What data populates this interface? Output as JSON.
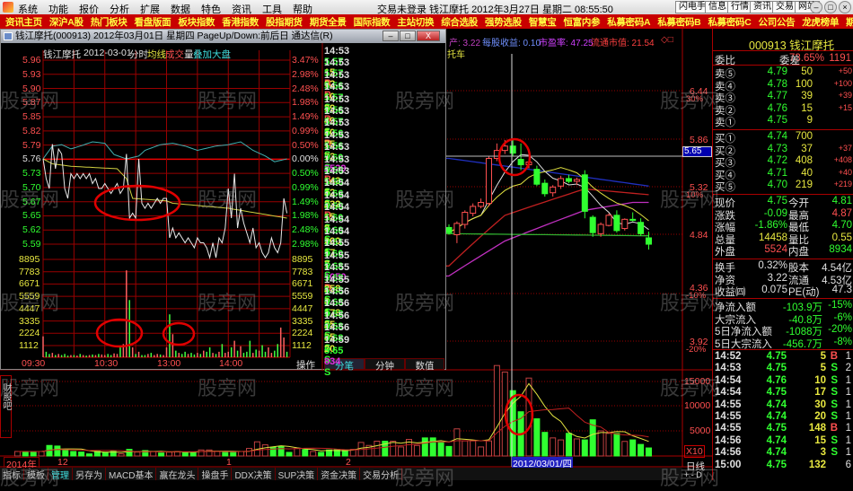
{
  "menubar": {
    "items": [
      "系统",
      "功能",
      "报价",
      "分析",
      "扩展",
      "数据",
      "特色",
      "资讯",
      "工具",
      "帮助"
    ],
    "status": "交易未登录 钱江摩托 2012年3月27日 星期二 08:55:50",
    "buttons": [
      "闪电手",
      "信息",
      "行情",
      "资讯",
      "交易",
      "网站"
    ]
  },
  "navbar": {
    "items": [
      "资讯主页",
      "深沪A股",
      "热门板块",
      "看盘版面",
      "板块指数",
      "香港指数",
      "股指期货",
      "期货全景",
      "国际指数",
      "主站切换",
      "综合选股",
      "强势选股",
      "智慧宝",
      "恒富内参",
      "私募密码A",
      "私募密码B",
      "私募密码C",
      "公司公告",
      "龙虎榜单",
      "期货龙虎"
    ]
  },
  "watermark": "股旁网",
  "popup": {
    "title": "钱江摩托(000913) 2012年03月01日 星期四 PageUp/Down:前后日 通达信(R)",
    "header": {
      "name": "钱江摩托",
      "date": "2012-03-01",
      "mode": "分时",
      "avg": "均线",
      "vol1": "成交",
      "vol2": "量",
      "overlay": "叠加大盘"
    },
    "price_labels": [
      "5.96",
      "5.93",
      "5.90",
      "5.87",
      "5.85",
      "5.82",
      "5.79",
      "5.76",
      "5.73",
      "5.70",
      "5.67",
      "5.65",
      "5.62",
      "5.59"
    ],
    "pct_labels": [
      "3.47%",
      "2.98%",
      "2.48%",
      "1.98%",
      "1.49%",
      "0.99%",
      "0.50%",
      "0.00%",
      "0.50%",
      "0.99%",
      "1.49%",
      "1.98%",
      "2.48%",
      "2.98%"
    ],
    "vol_labels": [
      "8895",
      "7783",
      "6671",
      "5559",
      "4447",
      "3335",
      "2224",
      "1112"
    ],
    "time_labels": [
      "09:30",
      "10:30",
      "13:00",
      "14:00"
    ],
    "op_label": "操作",
    "tabs": [
      "分笔",
      "分钟",
      "数值"
    ],
    "trades": [
      {
        "t": "14:53",
        "p": "5.57",
        "v": "15",
        "bs": "B"
      },
      {
        "t": "14:53",
        "p": "5.57",
        "v": "62",
        "bs": "B"
      },
      {
        "t": "14:53",
        "p": "5.56",
        "v": "10",
        "bs": "S"
      },
      {
        "t": "14:53",
        "p": "5.57",
        "v": "39",
        "bs": "B"
      },
      {
        "t": "14:53",
        "p": "5.56",
        "v": "49",
        "bs": "S"
      },
      {
        "t": "14:53",
        "p": "5.57",
        "v": "50",
        "bs": "B"
      },
      {
        "t": "14:53",
        "p": "5.56",
        "v": "75",
        "bs": "S"
      },
      {
        "t": "14:53",
        "p": "5.56",
        "v": "73",
        "bs": "S"
      },
      {
        "t": "14:53",
        "p": "5.60",
        "v": "2529",
        "bs": "B",
        "big": true
      },
      {
        "t": "14:53",
        "p": "5.60",
        "v": "143",
        "bs": "S"
      },
      {
        "t": "14:53",
        "p": "5.60",
        "v": "52",
        "bs": "S"
      },
      {
        "t": "14:54",
        "p": "5.66",
        "v": "232",
        "bs": "B"
      },
      {
        "t": "14:54",
        "p": "5.60",
        "v": "15",
        "bs": "S"
      },
      {
        "t": "14:54",
        "p": "5.60",
        "v": "8",
        "bs": "S"
      },
      {
        "t": "14:54",
        "p": "5.60",
        "v": "200",
        "bs": "S"
      },
      {
        "t": "14:54",
        "p": "5.61",
        "v": "17",
        "bs": "S"
      },
      {
        "t": "14:55",
        "p": "5.60",
        "v": "7",
        "bs": "S"
      },
      {
        "t": "14:55",
        "p": "5.68",
        "v": "1050",
        "bs": "B",
        "big": true
      },
      {
        "t": "14:55",
        "p": "5.68",
        "v": "258",
        "bs": "S"
      },
      {
        "t": "14:55",
        "p": "5.68",
        "v": "3",
        "bs": "S"
      },
      {
        "t": "14:56",
        "p": "5.68",
        "v": "178",
        "bs": "S"
      },
      {
        "t": "14:56",
        "p": "5.68",
        "v": "25",
        "bs": "S"
      },
      {
        "t": "14:56",
        "p": "5.68",
        "v": "35",
        "bs": "S"
      },
      {
        "t": "14:56",
        "p": "5.68",
        "v": "20",
        "bs": "S"
      },
      {
        "t": "14:59",
        "p": "5.65",
        "v": "834",
        "bs": "S",
        "big": true
      }
    ]
  },
  "intraday": {
    "prev_close": 5.76,
    "price": [
      5.76,
      5.72,
      5.7,
      5.79,
      5.74,
      5.78,
      5.77,
      5.7,
      5.68,
      5.73,
      5.72,
      5.73,
      5.72,
      5.73,
      5.72,
      5.73,
      5.71,
      5.72,
      5.7,
      5.7,
      5.71,
      5.7,
      5.69,
      5.7,
      5.71,
      5.69,
      5.7,
      5.77,
      5.64,
      5.65,
      5.64,
      5.76,
      5.67,
      5.66,
      5.67,
      5.66,
      5.67,
      5.68,
      5.67,
      5.68,
      5.68,
      5.6,
      5.62,
      5.6,
      5.61,
      5.6,
      5.59,
      5.6,
      5.59,
      5.58,
      5.6,
      5.59,
      5.59,
      5.58,
      5.56,
      5.59,
      5.56,
      5.6,
      5.59,
      5.62,
      5.7,
      5.64,
      5.73,
      5.62,
      5.66,
      5.63,
      5.61,
      5.59,
      5.62,
      5.58,
      5.59,
      5.57,
      5.56,
      5.57,
      5.6,
      5.58,
      5.57,
      5.59,
      5.68,
      5.65
    ],
    "avg_knots": [
      [
        0,
        5.76
      ],
      [
        3,
        5.75
      ],
      [
        9,
        5.745
      ],
      [
        24,
        5.74
      ],
      [
        27,
        5.72
      ],
      [
        29,
        5.68
      ],
      [
        40,
        5.675
      ],
      [
        42,
        5.67
      ],
      [
        60,
        5.66
      ],
      [
        79,
        5.64
      ]
    ],
    "index_pct_knots": [
      [
        0,
        0
      ],
      [
        3,
        0.45
      ],
      [
        6,
        0.5
      ],
      [
        9,
        0.35
      ],
      [
        12,
        0.45
      ],
      [
        16,
        0.6
      ],
      [
        20,
        0.55
      ],
      [
        23,
        0.15
      ],
      [
        27,
        0.0
      ],
      [
        31,
        0.1
      ],
      [
        33,
        0.3
      ],
      [
        38,
        0.5
      ],
      [
        42,
        0.55
      ],
      [
        46,
        0.45
      ],
      [
        50,
        0.3
      ],
      [
        56,
        0.45
      ],
      [
        60,
        0.5
      ],
      [
        64,
        0.6
      ],
      [
        68,
        0.3
      ],
      [
        72,
        0.1
      ],
      [
        75,
        -0.1
      ],
      [
        79,
        0.0
      ]
    ],
    "volume": [
      1900,
      500,
      300,
      400,
      200,
      300,
      200,
      300,
      150,
      200,
      200,
      150,
      300,
      200,
      150,
      200,
      250,
      200,
      300,
      250,
      200,
      300,
      200,
      350,
      300,
      900,
      1200,
      7900,
      5200,
      900,
      300,
      500,
      200,
      200,
      300,
      400,
      200,
      300,
      250,
      200,
      900,
      3900,
      2100,
      600,
      400,
      300,
      500,
      300,
      400,
      250,
      400,
      300,
      600,
      500,
      900,
      400,
      300,
      500,
      1200,
      400,
      500,
      900,
      1500,
      600,
      1000,
      400,
      500,
      1500,
      400,
      700,
      600,
      1100,
      500,
      900,
      400,
      600,
      1200,
      2700,
      1800,
      500
    ]
  },
  "kline": {
    "header": {
      "a": "产: 3.22",
      "b": "每股收益: 0.10",
      "c": "市盈率: 47.25",
      "d": "流通市值: 21.54",
      "sub": "托车",
      "icons": "◇□"
    },
    "axis": [
      {
        "p": "6.44",
        "pct": "30%"
      },
      {
        "p": "5.86",
        "pct": ""
      },
      {
        "p": "5.32",
        "pct": "10%"
      },
      {
        "p": "4.84",
        "pct": ""
      },
      {
        "p": "4.36",
        "pct": "-10%"
      },
      {
        "p": "3.92",
        "pct": "-20%"
      }
    ],
    "cursor_price": "5.65",
    "vol_axis": [
      "15000",
      "10000",
      "5000"
    ],
    "vol_unit": "X10",
    "period": "日线",
    "zoom_ctl": "+ - D",
    "date_labels": [
      "2014年",
      "12",
      "1",
      "2"
    ],
    "cursor_date": "2012/03/01/四",
    "side_tab": "财股吧",
    "candles": [
      [
        4.91,
        4.94,
        4.84,
        4.86
      ],
      [
        4.84,
        4.97,
        4.76,
        4.95
      ],
      [
        4.94,
        5.08,
        4.9,
        5.06
      ],
      [
        5.05,
        5.15,
        5.02,
        5.12
      ],
      [
        5.12,
        5.2,
        5.1,
        5.16
      ],
      [
        5.15,
        5.66,
        5.12,
        5.63
      ],
      [
        5.63,
        5.8,
        5.6,
        5.72
      ],
      [
        5.72,
        5.84,
        5.68,
        5.77
      ],
      [
        5.77,
        5.86,
        5.66,
        5.69
      ],
      [
        5.62,
        5.8,
        5.5,
        5.56
      ],
      [
        5.56,
        5.62,
        5.52,
        5.59
      ],
      [
        5.51,
        5.55,
        5.33,
        5.35
      ],
      [
        5.36,
        5.4,
        5.22,
        5.25
      ],
      [
        5.26,
        5.34,
        5.22,
        5.32
      ],
      [
        5.33,
        5.44,
        5.3,
        5.41
      ],
      [
        5.41,
        5.45,
        5.36,
        5.38
      ],
      [
        5.38,
        5.42,
        5.34,
        5.4
      ],
      [
        5.45,
        5.5,
        5.0,
        5.07
      ],
      [
        5.01,
        5.03,
        4.82,
        4.86
      ],
      [
        4.85,
        4.96,
        4.82,
        4.94
      ],
      [
        4.93,
        5.05,
        4.92,
        5.03
      ],
      [
        5.03,
        5.08,
        4.86,
        4.88
      ],
      [
        4.9,
        5.0,
        4.88,
        4.99
      ],
      [
        4.99,
        5.06,
        4.97,
        4.98
      ],
      [
        4.96,
        5.0,
        4.83,
        4.85
      ],
      [
        4.81,
        4.87,
        4.7,
        4.75
      ]
    ],
    "candle_volume": [
      1900,
      5400,
      3000,
      3000,
      1800,
      3000,
      18000,
      16700,
      13000,
      8800,
      15500,
      7400,
      4700,
      3600,
      3200,
      4500,
      3400,
      3200,
      7200,
      5000,
      4500,
      4500,
      2900,
      3200,
      2300,
      1600
    ],
    "pre_volume": [
      900,
      900,
      900,
      900,
      2100,
      1980,
      1200,
      900,
      780,
      420,
      1020,
      720,
      1020,
      420,
      1320,
      780,
      1080,
      900,
      600,
      780,
      900,
      780,
      780,
      1200,
      1200,
      900,
      720,
      720,
      900,
      1500,
      2820,
      2220,
      1740,
      1920,
      720,
      1500,
      1260,
      900,
      720,
      1200,
      1320,
      1200,
      1320,
      2700,
      2100,
      2940,
      2940,
      2940,
      1800,
      3300,
      2100,
      3600,
      3600,
      2700
    ],
    "pre_volume_up": "rggrgggggggggrgrgrgrrggrrrggrrrrgggrgrggggrrrrgrrrrg",
    "ma_long": {
      "blue": [
        [
          -54,
          5.7
        ],
        [
          0,
          5.63
        ],
        [
          25,
          5.33
        ]
      ],
      "red": [
        [
          -54,
          4.4
        ],
        [
          0,
          4.55
        ],
        [
          7,
          5.03
        ],
        [
          17,
          5.3
        ],
        [
          25,
          5.24
        ]
      ],
      "magenta": [
        [
          -54,
          4.3
        ],
        [
          0,
          4.46
        ],
        [
          7,
          4.78
        ],
        [
          17,
          5.08
        ],
        [
          23,
          5.16
        ],
        [
          25,
          5.16
        ]
      ],
      "green": [
        [
          -54,
          4.88
        ],
        [
          0,
          4.85
        ],
        [
          25,
          4.83
        ]
      ]
    },
    "colors": {
      "up": "#ff5050",
      "down": "#30ff30",
      "ma5": "#e0e0e0",
      "ma10": "#e0e040"
    }
  },
  "quote": {
    "title": "000913 钱江摩托",
    "wb": {
      "l": "委比",
      "v": "73.65%",
      "l2": "委差",
      "v2": "1191"
    },
    "sell": [
      {
        "l": "卖⑤",
        "p": "4.79",
        "v": "50",
        "c": "+50"
      },
      {
        "l": "卖④",
        "p": "4.78",
        "v": "100",
        "c": "+100"
      },
      {
        "l": "卖③",
        "p": "4.77",
        "v": "39",
        "c": "+39"
      },
      {
        "l": "卖②",
        "p": "4.76",
        "v": "15",
        "c": "+15"
      },
      {
        "l": "卖①",
        "p": "4.75",
        "v": "9",
        "c": ""
      }
    ],
    "buy": [
      {
        "l": "买①",
        "p": "4.74",
        "v": "700",
        "c": ""
      },
      {
        "l": "买②",
        "p": "4.73",
        "v": "37",
        "c": "+37"
      },
      {
        "l": "买③",
        "p": "4.72",
        "v": "408",
        "c": "+408"
      },
      {
        "l": "买④",
        "p": "4.71",
        "v": "40",
        "c": "+40"
      },
      {
        "l": "买⑤",
        "p": "4.70",
        "v": "219",
        "c": "+219"
      }
    ],
    "stats": [
      {
        "l": "现价",
        "v": "4.75",
        "vc": "grn",
        "l2": "今开",
        "v2": "4.81",
        "v2c": "grn"
      },
      {
        "l": "涨跌",
        "v": "-0.09",
        "vc": "grn",
        "l2": "最高",
        "v2": "4.87",
        "v2c": "red"
      },
      {
        "l": "涨幅",
        "v": "-1.86%",
        "vc": "grn",
        "l2": "最低",
        "v2": "4.70",
        "v2c": "grn"
      },
      {
        "l": "总量",
        "v": "14458",
        "vc": "yel",
        "l2": "量比",
        "v2": "0.55",
        "v2c": "yel"
      },
      {
        "l": "外盘",
        "v": "5524",
        "vc": "red",
        "l2": "内盘",
        "v2": "8934",
        "v2c": "grn"
      }
    ],
    "fund": [
      {
        "l": "换手",
        "v": "0.32%",
        "l2": "股本",
        "v2": "4.54亿"
      },
      {
        "l": "净资",
        "v": "3.22",
        "l2": "流通",
        "v2": "4.53亿"
      },
      {
        "l": "收益㈣",
        "v": "0.075",
        "l2": "PE(动)",
        "v2": "47.3"
      }
    ],
    "flow": [
      {
        "l": "净流入额",
        "v": "-103.9万",
        "p": "-15%"
      },
      {
        "l": "大宗流入",
        "v": "-40.8万",
        "p": "-6%"
      },
      {
        "l": "5日净流入额",
        "v": "-1088万",
        "p": "-20%"
      },
      {
        "l": "5日大宗流入",
        "v": "-456.7万",
        "p": "-8%"
      }
    ],
    "ticks": [
      {
        "t": "14:52",
        "p": "4.75",
        "v": "5",
        "bs": "B",
        "n": "1"
      },
      {
        "t": "14:53",
        "p": "4.75",
        "v": "5",
        "bs": "S",
        "n": "2"
      },
      {
        "t": "14:54",
        "p": "4.76",
        "v": "10",
        "bs": "S",
        "n": "1"
      },
      {
        "t": "14:54",
        "p": "4.75",
        "v": "17",
        "bs": "S",
        "n": "1"
      },
      {
        "t": "14:55",
        "p": "4.74",
        "v": "30",
        "bs": "S",
        "n": "1"
      },
      {
        "t": "14:55",
        "p": "4.74",
        "v": "20",
        "bs": "S",
        "n": "1"
      },
      {
        "t": "14:55",
        "p": "4.75",
        "v": "148",
        "bs": "B",
        "n": "1"
      },
      {
        "t": "14:56",
        "p": "4.74",
        "v": "15",
        "bs": "S",
        "n": "1"
      },
      {
        "t": "14:56",
        "p": "4.74",
        "v": "3",
        "bs": "S",
        "n": "1"
      },
      {
        "t": "15:00",
        "p": "4.75",
        "v": "132",
        "bs": "",
        "n": "6"
      }
    ]
  },
  "bottombar": {
    "items": [
      "指标",
      "模板",
      "管理",
      "另存为",
      "MACD基本",
      "赢在龙头",
      "操盘手",
      "DDX决策",
      "SUP决策",
      "资金决策",
      "交易分析"
    ]
  }
}
